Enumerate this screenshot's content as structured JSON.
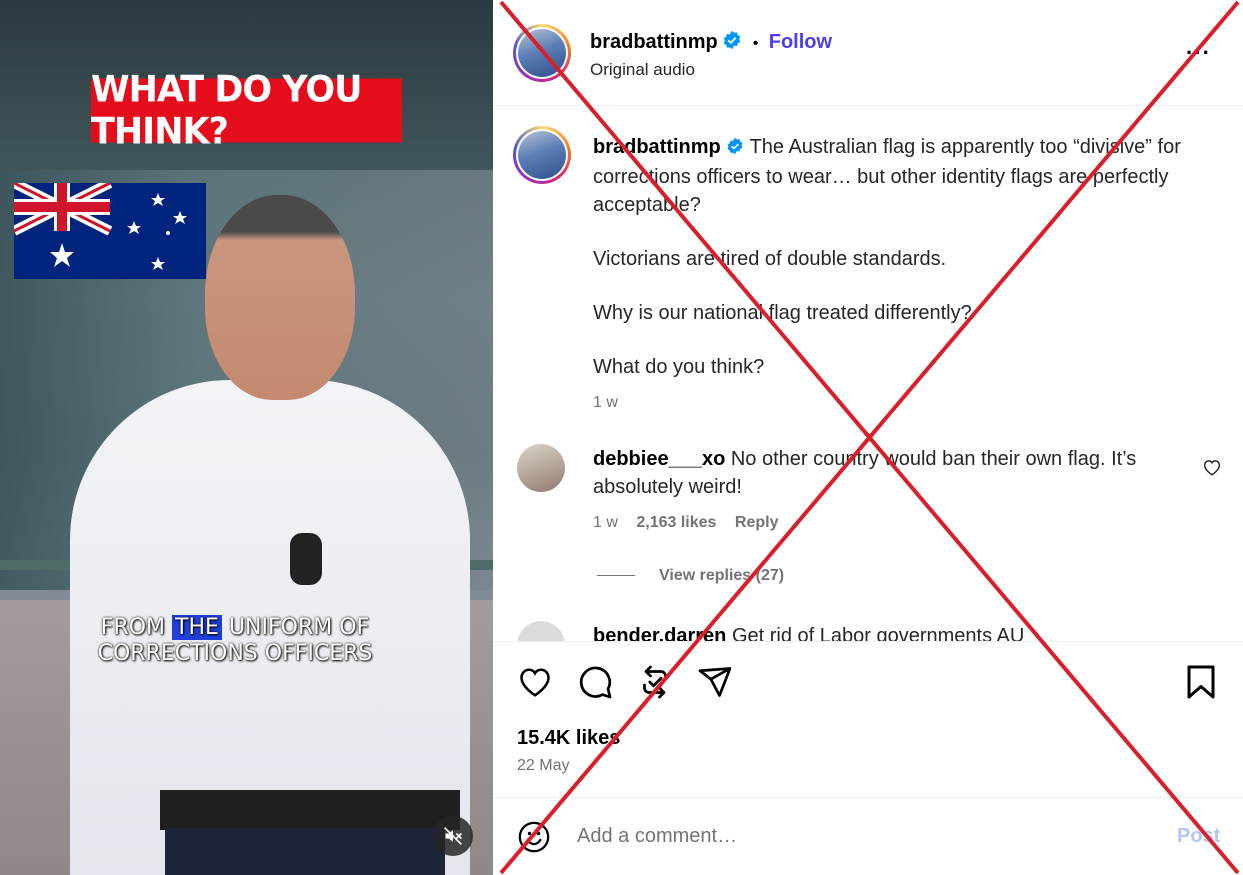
{
  "video": {
    "overlay_title": "WHAT DO YOU THINK?",
    "caption_before": "FROM",
    "caption_highlight": "THE",
    "caption_after": "UNIFORM OF",
    "caption_line2": "CORRECTIONS OFFICERS"
  },
  "header": {
    "username": "bradbattinmp",
    "separator": "•",
    "follow_label": "Follow",
    "audio": "Original audio",
    "more": "···"
  },
  "post": {
    "username": "bradbattinmp",
    "caption": [
      "The Australian flag is apparently too “divisive” for corrections officers to wear… but other identity flags are perfectly acceptable?",
      "Victorians are tired of double standards.",
      "Why is our national flag treated differently?",
      "What do you think?"
    ],
    "time": "1 w"
  },
  "comments": [
    {
      "username": "debbiee___xo",
      "text": "No other country would ban their own flag. It’s absolutely weird!",
      "time": "1 w",
      "likes": "2,163 likes",
      "reply": "Reply",
      "view_replies": "View replies (27)"
    },
    {
      "username": "bender.darren",
      "text": "Get rid of Labor governments AU"
    }
  ],
  "actions": {
    "likes": "15.4K likes",
    "date": "22 May"
  },
  "comment_bar": {
    "placeholder": "Add a comment…",
    "post_label": "Post"
  },
  "colors": {
    "follow": "#4e3df0",
    "verified": "#0095f6",
    "overlay_red": "#e50c1c",
    "cross_red": "#d8202a"
  }
}
